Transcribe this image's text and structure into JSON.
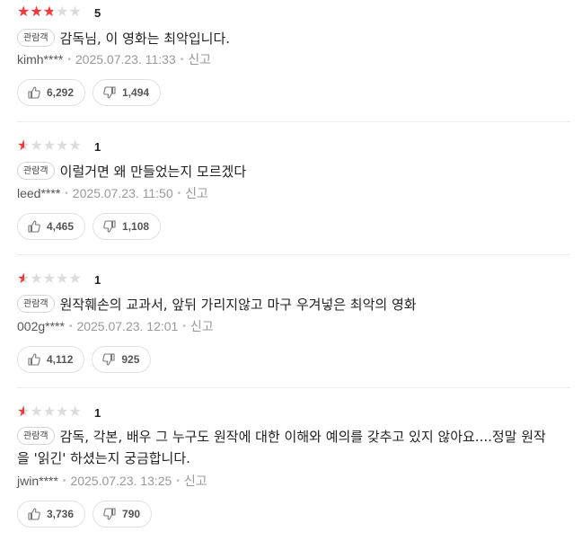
{
  "reviews": [
    {
      "rating": 2.5,
      "rating_text": "5",
      "badge": "관람객",
      "text": "감독님, 이 영화는 최악입니다.",
      "user": "kimh****",
      "date": "2025.07.23. 11:33",
      "report": "신고",
      "likes": "6,292",
      "dislikes": "1,494"
    },
    {
      "rating": 0.5,
      "rating_text": "1",
      "badge": "관람객",
      "text": "이럴거면 왜 만들었는지 모르겠다",
      "user": "leed****",
      "date": "2025.07.23. 11:50",
      "report": "신고",
      "likes": "4,465",
      "dislikes": "1,108"
    },
    {
      "rating": 0.5,
      "rating_text": "1",
      "badge": "관람객",
      "text": "원작훼손의 교과서, 앞뒤 가리지않고 마구 우겨넣은 최악의 영화",
      "user": "002g****",
      "date": "2025.07.23. 12:01",
      "report": "신고",
      "likes": "4,112",
      "dislikes": "925"
    },
    {
      "rating": 0.5,
      "rating_text": "1",
      "badge": "관람객",
      "text": "감독, 각본, 배우 그 누구도 원작에 대한 이해와 예의를 갖추고 있지 않아요....정말 원작을 '읽긴' 하셨는지 궁금합니다.",
      "user": "jwin****",
      "date": "2025.07.23. 13:25",
      "report": "신고",
      "likes": "3,736",
      "dislikes": "790"
    }
  ],
  "colors": {
    "star": "#f23a3a",
    "star_empty": "#dcdcdc"
  },
  "icons": {
    "like": "thumbs-up-icon",
    "dislike": "thumbs-down-icon"
  }
}
